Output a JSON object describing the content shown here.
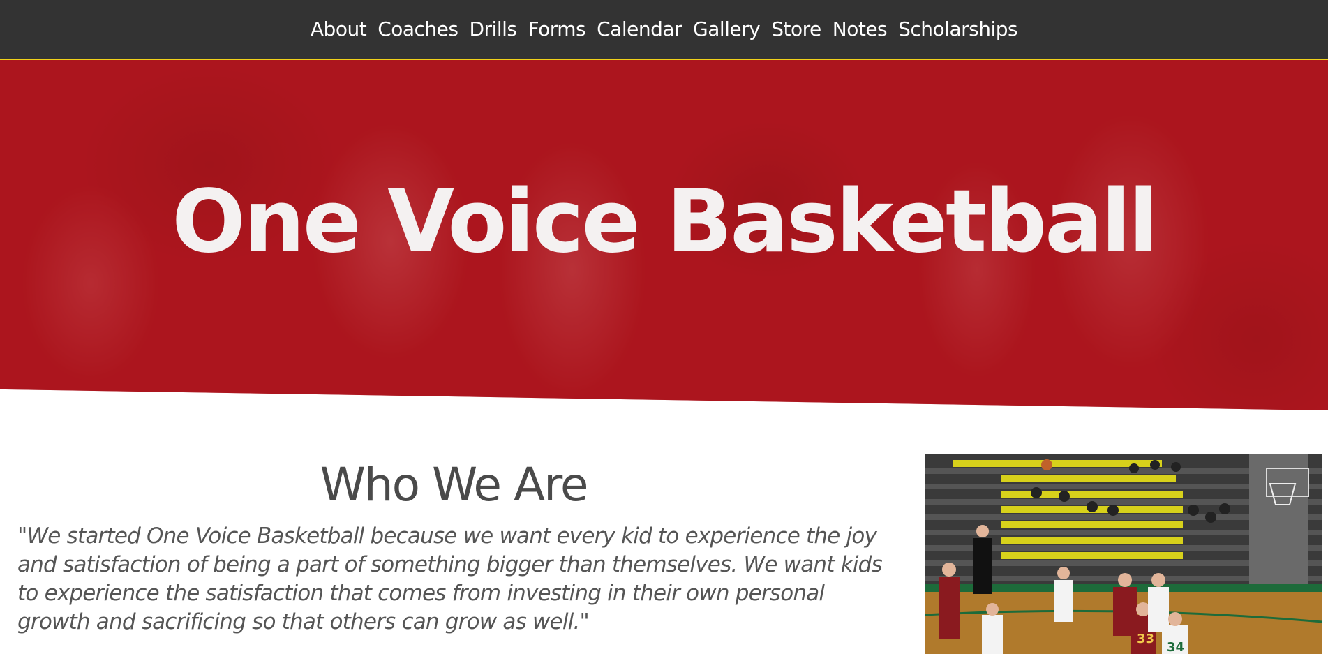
{
  "nav": {
    "items": [
      "About",
      "Coaches",
      "Drills",
      "Forms",
      "Calendar",
      "Gallery",
      "Store",
      "Notes",
      "Scholarships"
    ]
  },
  "hero": {
    "title": "One Voice Basketball"
  },
  "about": {
    "heading": "Who We Are",
    "quote": "\"We started One Voice Basketball because we want every kid to experience the joy and satisfaction of being a part of something bigger than themselves. We want kids to experience the satisfaction that comes from investing in their own personal growth and sacrificing so that others can grow as well.\""
  },
  "photo": {
    "jersey_numbers": [
      "33",
      "34"
    ]
  },
  "colors": {
    "nav_bg": "#333333",
    "nav_border": "#f0d21a",
    "hero_red": "#af161e",
    "heading_text": "#4a4a4a",
    "body_text": "#555555"
  }
}
